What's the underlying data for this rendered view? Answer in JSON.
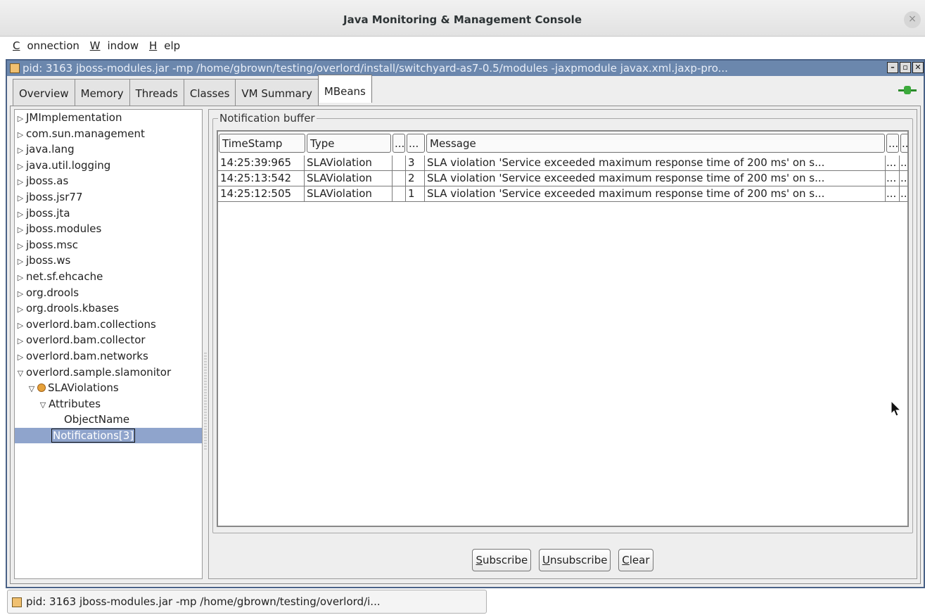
{
  "window": {
    "title": "Java Monitoring & Management Console",
    "close_glyph": "×"
  },
  "menubar": {
    "items": [
      {
        "first": "C",
        "rest": "onnection"
      },
      {
        "first": "W",
        "rest": "indow"
      },
      {
        "first": "H",
        "rest": "elp"
      }
    ]
  },
  "internal_frame": {
    "title": "pid: 3163 jboss-modules.jar -mp /home/gbrown/testing/overlord/install/switchyard-as7-0.5/modules -jaxpmodule javax.xml.jaxp-pro..."
  },
  "tabs": [
    "Overview",
    "Memory",
    "Threads",
    "Classes",
    "VM Summary",
    "MBeans"
  ],
  "active_tab": "MBeans",
  "tree": {
    "nodes": [
      {
        "label": "JMImplementation",
        "state": "collapsed"
      },
      {
        "label": "com.sun.management",
        "state": "collapsed"
      },
      {
        "label": "java.lang",
        "state": "collapsed"
      },
      {
        "label": "java.util.logging",
        "state": "collapsed"
      },
      {
        "label": "jboss.as",
        "state": "collapsed"
      },
      {
        "label": "jboss.jsr77",
        "state": "collapsed"
      },
      {
        "label": "jboss.jta",
        "state": "collapsed"
      },
      {
        "label": "jboss.modules",
        "state": "collapsed"
      },
      {
        "label": "jboss.msc",
        "state": "collapsed"
      },
      {
        "label": "jboss.ws",
        "state": "collapsed"
      },
      {
        "label": "net.sf.ehcache",
        "state": "collapsed"
      },
      {
        "label": "org.drools",
        "state": "collapsed"
      },
      {
        "label": "org.drools.kbases",
        "state": "collapsed"
      },
      {
        "label": "overlord.bam.collections",
        "state": "collapsed"
      },
      {
        "label": "overlord.bam.collector",
        "state": "collapsed"
      },
      {
        "label": "overlord.bam.networks",
        "state": "collapsed"
      },
      {
        "label": "overlord.sample.slamonitor",
        "state": "expanded"
      },
      {
        "label": "SLAViolations",
        "state": "expanded",
        "bean": true
      },
      {
        "label": "Attributes",
        "state": "expanded"
      },
      {
        "label": "ObjectName",
        "state": "leaf"
      },
      {
        "label": "Notifications[3]",
        "state": "leaf",
        "selected": true
      }
    ]
  },
  "notification_buffer": {
    "label": "Notification buffer",
    "columns": [
      "TimeStamp",
      "Type",
      "...",
      "...",
      "Message",
      "...",
      "..."
    ],
    "rows": [
      [
        "14:25:39:965",
        "SLAViolation",
        "",
        "3",
        "SLA violation 'Service exceeded maximum response time of 200 ms' on s...",
        "...",
        "..."
      ],
      [
        "14:25:13:542",
        "SLAViolation",
        "",
        "2",
        "SLA violation 'Service exceeded maximum response time of 200 ms' on s...",
        "...",
        "..."
      ],
      [
        "14:25:12:505",
        "SLAViolation",
        "",
        "1",
        "SLA violation 'Service exceeded maximum response time of 200 ms' on s...",
        "...",
        "..."
      ]
    ]
  },
  "buttons": [
    {
      "first": "S",
      "rest": "ubscribe"
    },
    {
      "first": "U",
      "rest": "nsubscribe"
    },
    {
      "first": "C",
      "rest": "lear"
    }
  ],
  "taskbar": {
    "item_label": "pid: 3163 jboss-modules.jar -mp /home/gbrown/testing/overlord/i..."
  },
  "colors": {
    "selection": "#8fa4cc",
    "frame_title": "#6b87ad",
    "connected_plug": "#3caa3c"
  },
  "icons": [
    "java-app-icon",
    "connection-plug-icon",
    "mbean-icon",
    "tree-expand-icon",
    "tree-collapse-icon",
    "mouse-cursor-icon"
  ]
}
